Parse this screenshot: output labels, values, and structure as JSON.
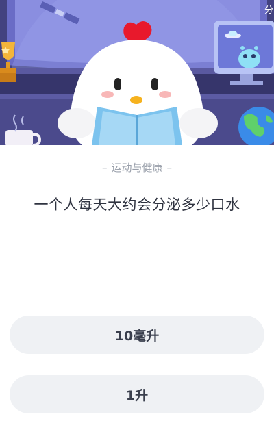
{
  "header": {
    "share_hint": "分享"
  },
  "question": {
    "category": "运动与健康",
    "dash_left": "–",
    "dash_right": "–",
    "text": "一个人每天大约会分泌多少口水"
  },
  "options": [
    {
      "label": "10毫升"
    },
    {
      "label": "1升"
    }
  ],
  "colors": {
    "banner_bg": "#3f3e7a",
    "option_bg": "#eff1f4",
    "question_text": "#2f3340",
    "category_text": "#9aa0ab"
  }
}
